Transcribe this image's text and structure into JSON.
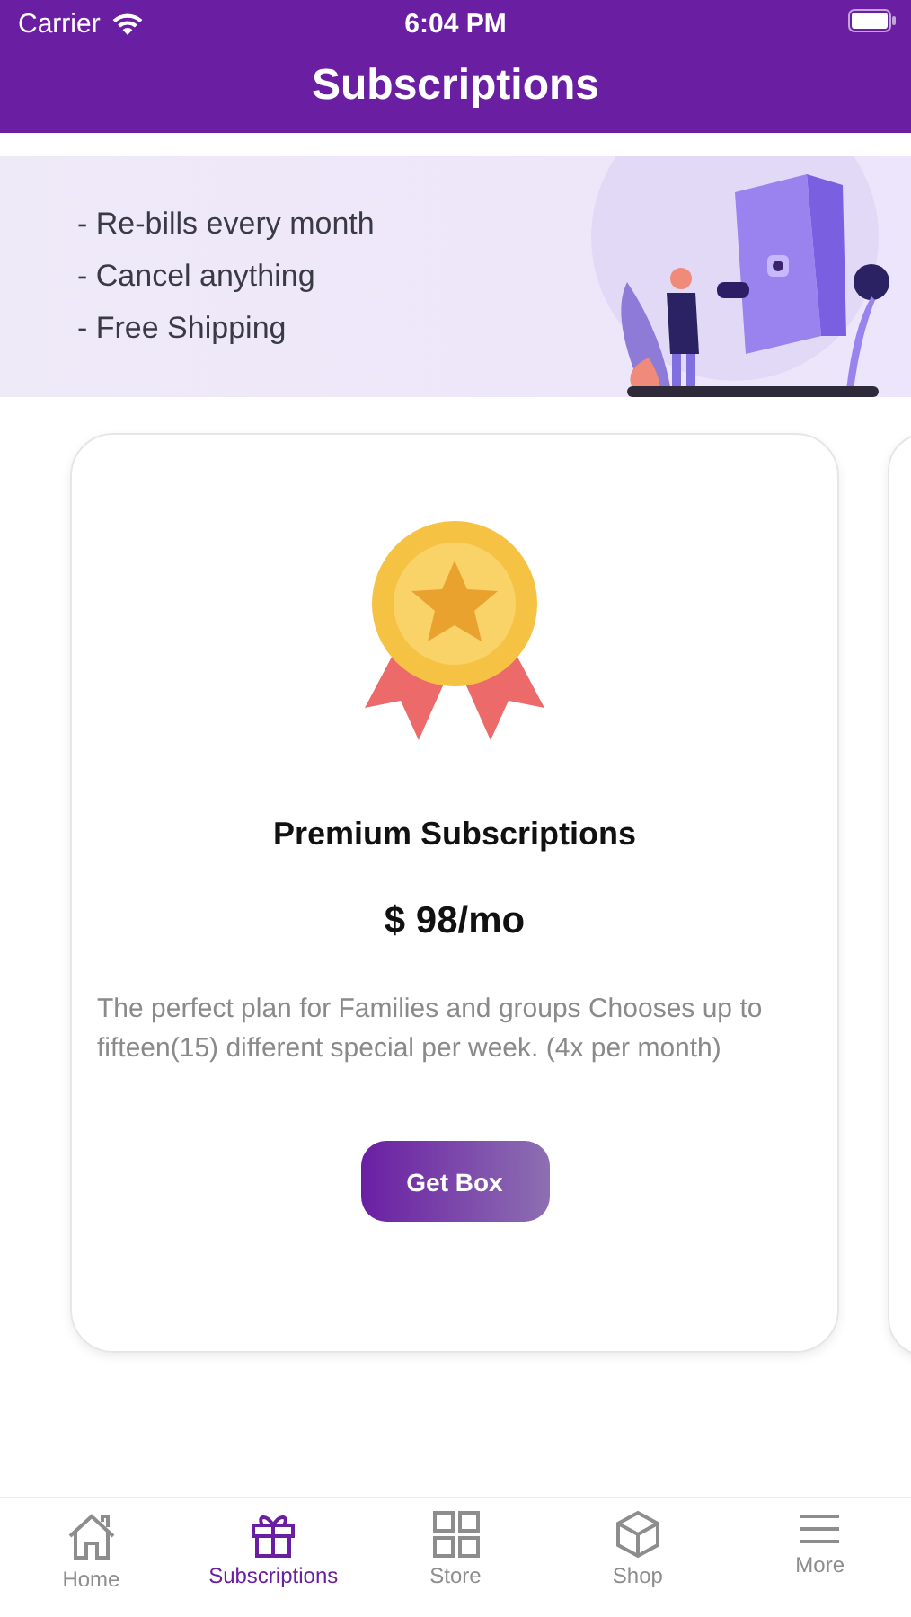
{
  "status_bar": {
    "carrier": "Carrier",
    "time": "6:04 PM"
  },
  "header": {
    "title": "Subscriptions"
  },
  "banner": {
    "lines": [
      "- Re-bills every month",
      "- Cancel anything",
      "- Free Shipping"
    ]
  },
  "plans": [
    {
      "title": "Premium Subscriptions",
      "price": "$ 98/mo",
      "description": "The perfect plan for Families and groups Chooses up to fifteen(15) different special per week. (4x per month)",
      "button": "Get Box"
    }
  ],
  "tabs": [
    {
      "label": "Home",
      "selected": false
    },
    {
      "label": "Subscriptions",
      "selected": true
    },
    {
      "label": "Store",
      "selected": false
    },
    {
      "label": "Shop",
      "selected": false
    },
    {
      "label": "More",
      "selected": false
    }
  ]
}
